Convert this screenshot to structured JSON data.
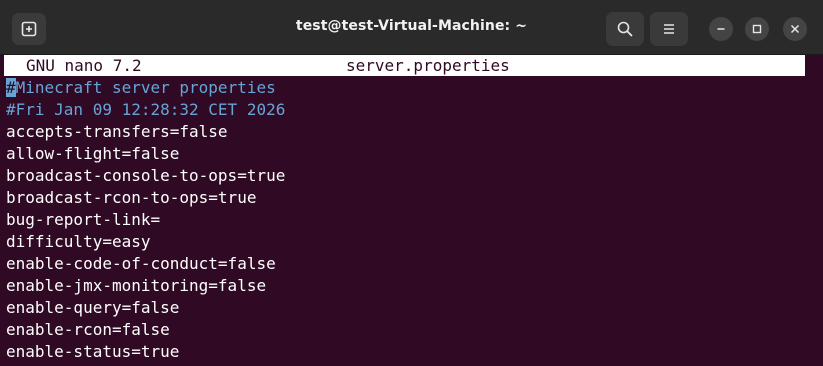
{
  "window": {
    "title": "test@test-Virtual-Machine: ~"
  },
  "icons": {
    "new_tab": "new-tab-icon",
    "search": "search-icon",
    "menu": "hamburger-menu-icon",
    "minimize": "minimize-icon",
    "maximize": "maximize-icon",
    "close": "close-icon"
  },
  "nano": {
    "version": "GNU nano 7.2",
    "filename": "server.properties"
  },
  "editor": {
    "cursor_char": "#",
    "first_line_rest": "Minecraft server properties",
    "lines": [
      "#Fri Jan 09 12:28:32 CET 2026",
      "accepts-transfers=false",
      "allow-flight=false",
      "broadcast-console-to-ops=true",
      "broadcast-rcon-to-ops=true",
      "bug-report-link=",
      "difficulty=easy",
      "enable-code-of-conduct=false",
      "enable-jmx-monitoring=false",
      "enable-query=false",
      "enable-rcon=false",
      "enable-status=true"
    ]
  },
  "colors": {
    "background": "#300a24",
    "titlebar": "#2a2a2a",
    "comment": "#66a4d6",
    "text": "#ffffff"
  }
}
